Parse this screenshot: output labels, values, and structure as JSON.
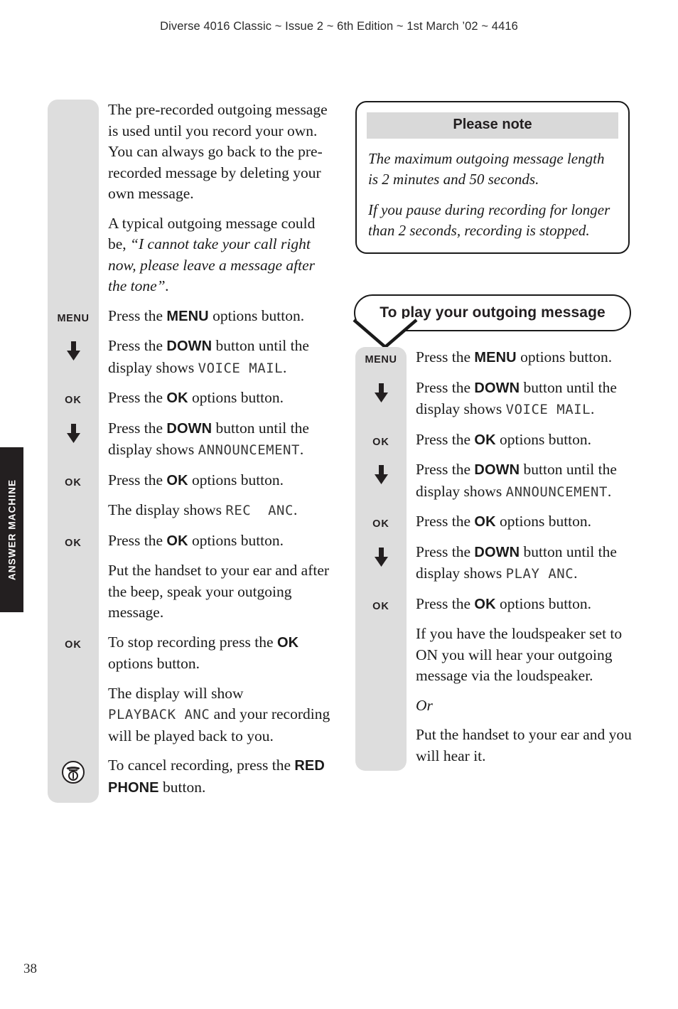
{
  "header": {
    "running_head": "Diverse 4016 Classic ~ Issue 2 ~ 6th Edition ~ 1st March ’02 ~ 4416"
  },
  "side_tab": {
    "label": "ANSWER MACHINE"
  },
  "folio": {
    "page_number": "38"
  },
  "colors": {
    "gutter_grey": "#dddddd",
    "note_title_grey": "#d9d9d9",
    "ink": "#1a1a1a",
    "tab_black": "#231f20"
  },
  "left_column": {
    "intro": {
      "p1": "The pre-recorded outgoing message is used until you record your own. You can always go back to the pre-recorded message by deleting your own message.",
      "p2_lead": "A typical outgoing message could be,",
      "p2_quote": "“I cannot take your call right now, please leave a message after the tone”."
    },
    "steps": [
      {
        "icon": "menu-key",
        "icon_label": "MENU",
        "text_before": "Press the ",
        "keyword": "MENU",
        "text_after": " options button."
      },
      {
        "icon": "down-arrow",
        "icon_label": "",
        "text_before": "Press the ",
        "keyword": "DOWN",
        "text_after": " button until the display shows ",
        "lcd": "VOICE MAIL",
        "text_end": "."
      },
      {
        "icon": "ok-key",
        "icon_label": "OK",
        "text_before": "Press the ",
        "keyword": "OK",
        "text_after": " options button."
      },
      {
        "icon": "down-arrow",
        "icon_label": "",
        "text_before": "Press the ",
        "keyword": "DOWN",
        "text_after": " button until the display shows ",
        "lcd": "ANNOUNCEMENT",
        "text_end": "."
      },
      {
        "icon": "ok-key",
        "icon_label": "OK",
        "text_before": "Press the ",
        "keyword": "OK",
        "text_after": " options button."
      },
      {
        "icon": "none",
        "icon_label": "",
        "text_before": "The display shows ",
        "keyword": "",
        "text_after": "",
        "lcd": "REC  ANC",
        "text_end": "."
      },
      {
        "icon": "ok-key",
        "icon_label": "OK",
        "text_before": "Press the ",
        "keyword": "OK",
        "text_after": " options button."
      },
      {
        "icon": "none",
        "icon_label": "",
        "text_before": "Put the handset to your ear and after the beep, speak your outgoing message.",
        "keyword": "",
        "text_after": ""
      },
      {
        "icon": "ok-key",
        "icon_label": "OK",
        "text_before": "To stop recording press the ",
        "keyword": "OK",
        "text_after": " options button."
      },
      {
        "icon": "none",
        "icon_label": "",
        "text_before": "The display will show ",
        "keyword": "",
        "lcd": "PLAYBACK ANC",
        "text_end": " and your recording will be played back to you."
      },
      {
        "icon": "red-phone",
        "icon_label": "",
        "text_before": "To cancel recording, press the ",
        "keyword": "RED PHONE",
        "text_after": " button."
      }
    ]
  },
  "note_box": {
    "title": "Please note",
    "paragraphs": [
      "The maximum outgoing message length is 2 minutes and 50 seconds.",
      "If you pause during recording for longer than 2 seconds, recording is stopped."
    ]
  },
  "bubble": {
    "heading": "To play your outgoing message"
  },
  "right_column": {
    "steps": [
      {
        "icon": "menu-key",
        "icon_label": "MENU",
        "text_before": "Press the ",
        "keyword": "MENU",
        "text_after": " options button."
      },
      {
        "icon": "down-arrow",
        "icon_label": "",
        "text_before": "Press the ",
        "keyword": "DOWN",
        "text_after": " button until the display shows ",
        "lcd": "VOICE MAIL",
        "text_end": "."
      },
      {
        "icon": "ok-key",
        "icon_label": "OK",
        "text_before": "Press the ",
        "keyword": "OK",
        "text_after": " options button."
      },
      {
        "icon": "down-arrow",
        "icon_label": "",
        "text_before": "Press the ",
        "keyword": "DOWN",
        "text_after": " button until the display shows ",
        "lcd": "ANNOUNCEMENT",
        "text_end": "."
      },
      {
        "icon": "ok-key",
        "icon_label": "OK",
        "text_before": "Press the ",
        "keyword": "OK",
        "text_after": " options button."
      },
      {
        "icon": "down-arrow",
        "icon_label": "",
        "text_before": "Press the ",
        "keyword": "DOWN",
        "text_after": " button until the display shows ",
        "lcd": "PLAY ANC",
        "text_end": "."
      },
      {
        "icon": "ok-key",
        "icon_label": "OK",
        "text_before": "Press the ",
        "keyword": "OK",
        "text_after": " options button."
      },
      {
        "icon": "none",
        "icon_label": "",
        "text_before": "If you have the loudspeaker set to ON you will hear your outgoing message via the loudspeaker.",
        "keyword": "",
        "text_after": ""
      },
      {
        "icon": "none",
        "icon_label": "",
        "italic_text": "Or"
      },
      {
        "icon": "none",
        "icon_label": "",
        "text_before": "Put the handset to your ear and you will hear it.",
        "keyword": "",
        "text_after": ""
      }
    ]
  }
}
